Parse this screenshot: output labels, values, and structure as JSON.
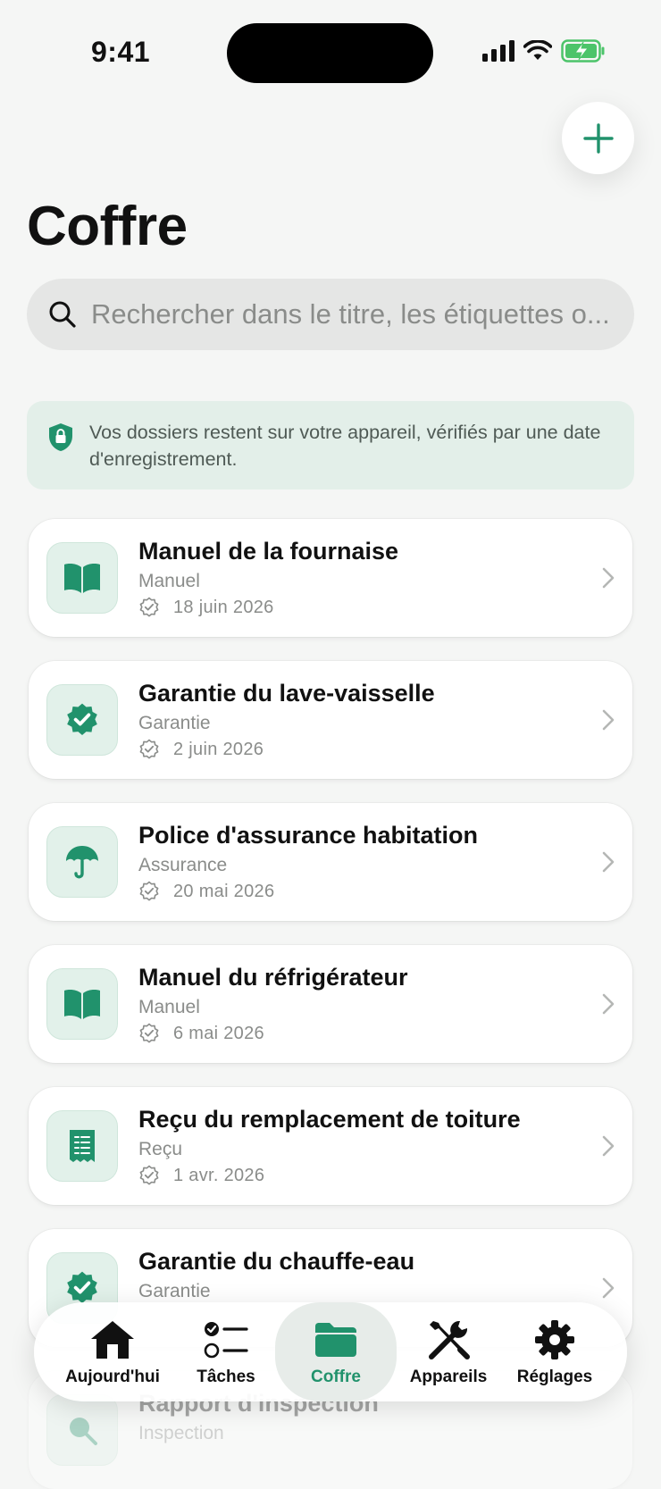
{
  "status": {
    "time": "9:41"
  },
  "page": {
    "title": "Coffre"
  },
  "search": {
    "placeholder": "Rechercher dans le titre, les étiquettes o..."
  },
  "privacy_notice": "Vos dossiers restent sur votre appareil, vérifiés par une date d'enregistrement.",
  "documents": [
    {
      "title": "Manuel de la fournaise",
      "type": "Manuel",
      "date": "18 juin 2026",
      "icon": "book-icon"
    },
    {
      "title": "Garantie du lave-vaisselle",
      "type": "Garantie",
      "date": "2 juin 2026",
      "icon": "verified-seal-icon"
    },
    {
      "title": "Police d'assurance habitation",
      "type": "Assurance",
      "date": "20 mai 2026",
      "icon": "umbrella-icon"
    },
    {
      "title": "Manuel du réfrigérateur",
      "type": "Manuel",
      "date": "6 mai 2026",
      "icon": "book-icon"
    },
    {
      "title": "Reçu du remplacement de toiture",
      "type": "Reçu",
      "date": "1 avr. 2026",
      "icon": "receipt-icon"
    },
    {
      "title": "Garantie du chauffe-eau",
      "type": "Garantie",
      "date": "",
      "icon": "verified-seal-icon"
    },
    {
      "title": "Rapport d'inspection",
      "type": "Inspection",
      "date": "",
      "icon": "search-icon"
    }
  ],
  "tabs": [
    {
      "label": "Aujourd'hui",
      "icon": "house-icon",
      "active": false
    },
    {
      "label": "Tâches",
      "icon": "checklist-icon",
      "active": false
    },
    {
      "label": "Coffre",
      "icon": "folder-icon",
      "active": true
    },
    {
      "label": "Appareils",
      "icon": "tools-icon",
      "active": false
    },
    {
      "label": "Réglages",
      "icon": "gear-icon",
      "active": false
    }
  ],
  "colors": {
    "accent": "#21926c",
    "background": "#f5f6f5",
    "banner": "#e3efe9",
    "icon_tile": "#e2f1ea"
  }
}
